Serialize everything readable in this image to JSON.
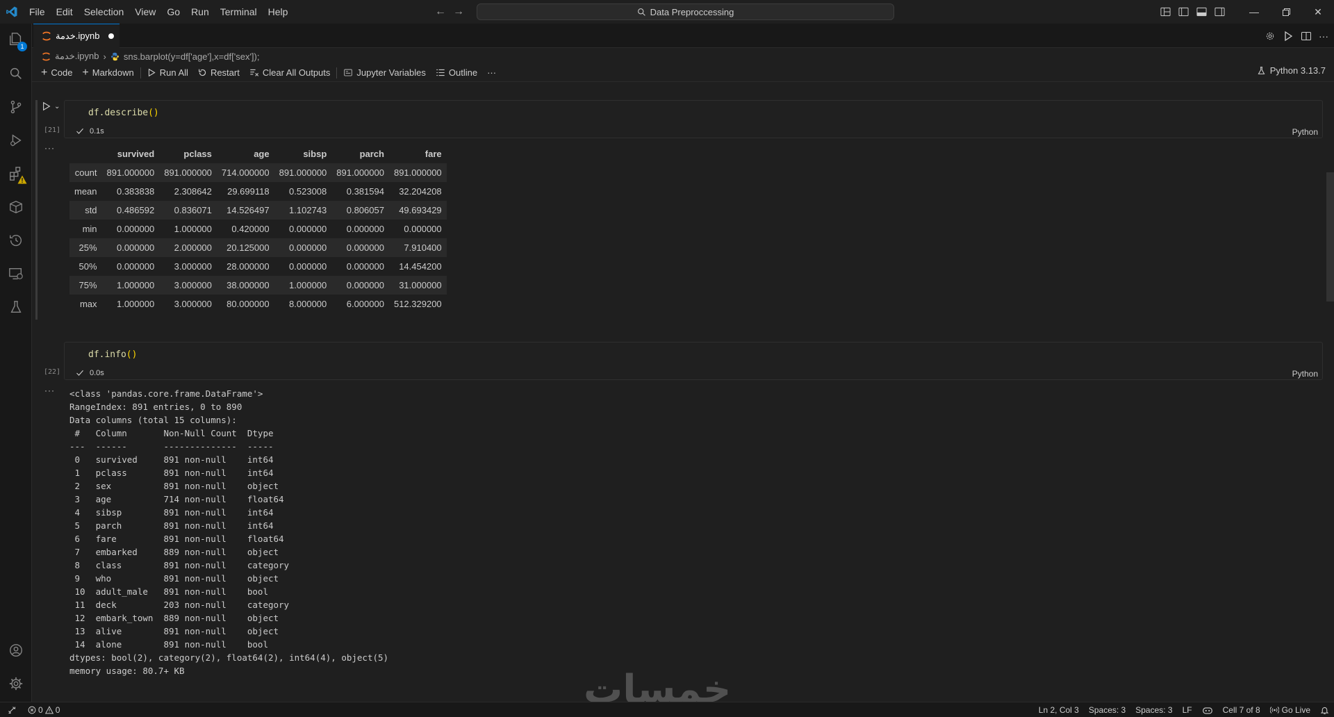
{
  "menu": [
    "File",
    "Edit",
    "Selection",
    "View",
    "Go",
    "Run",
    "Terminal",
    "Help"
  ],
  "command_center": "Data Preproccessing",
  "tab": {
    "filename": "خدمة.ipynb"
  },
  "breadcrumb": {
    "file": "خدمة.ipynb",
    "cell": "sns.barplot(y=df['age'],x=df['sex']);"
  },
  "toolbar": {
    "code": "Code",
    "markdown": "Markdown",
    "run_all": "Run All",
    "restart": "Restart",
    "clear_outputs": "Clear All Outputs",
    "variables": "Jupyter Variables",
    "outline": "Outline",
    "more": "···",
    "kernel": "Python 3.13.7"
  },
  "cells": [
    {
      "count": "[21]",
      "code_fn": "df.describe",
      "code_paren": "()",
      "time": "0.1s",
      "lang": "Python",
      "output_more": "···"
    },
    {
      "count": "[22]",
      "code_fn": "df.info",
      "code_paren": "()",
      "time": "0.0s",
      "lang": "Python",
      "output_more": "···"
    }
  ],
  "describe": {
    "columns": [
      "",
      "survived",
      "pclass",
      "age",
      "sibsp",
      "parch",
      "fare"
    ],
    "rows": [
      [
        "count",
        "891.000000",
        "891.000000",
        "714.000000",
        "891.000000",
        "891.000000",
        "891.000000"
      ],
      [
        "mean",
        "0.383838",
        "2.308642",
        "29.699118",
        "0.523008",
        "0.381594",
        "32.204208"
      ],
      [
        "std",
        "0.486592",
        "0.836071",
        "14.526497",
        "1.102743",
        "0.806057",
        "49.693429"
      ],
      [
        "min",
        "0.000000",
        "1.000000",
        "0.420000",
        "0.000000",
        "0.000000",
        "0.000000"
      ],
      [
        "25%",
        "0.000000",
        "2.000000",
        "20.125000",
        "0.000000",
        "0.000000",
        "7.910400"
      ],
      [
        "50%",
        "0.000000",
        "3.000000",
        "28.000000",
        "0.000000",
        "0.000000",
        "14.454200"
      ],
      [
        "75%",
        "1.000000",
        "3.000000",
        "38.000000",
        "1.000000",
        "0.000000",
        "31.000000"
      ],
      [
        "max",
        "1.000000",
        "3.000000",
        "80.000000",
        "8.000000",
        "6.000000",
        "512.329200"
      ]
    ]
  },
  "info_lines": [
    "<class 'pandas.core.frame.DataFrame'>",
    "RangeIndex: 891 entries, 0 to 890",
    "Data columns (total 15 columns):",
    " #   Column       Non-Null Count  Dtype   ",
    "---  ------       --------------  -----   ",
    " 0   survived     891 non-null    int64   ",
    " 1   pclass       891 non-null    int64   ",
    " 2   sex          891 non-null    object  ",
    " 3   age          714 non-null    float64 ",
    " 4   sibsp        891 non-null    int64   ",
    " 5   parch        891 non-null    int64   ",
    " 6   fare         891 non-null    float64 ",
    " 7   embarked     889 non-null    object  ",
    " 8   class        891 non-null    category",
    " 9   who          891 non-null    object  ",
    " 10  adult_male   891 non-null    bool    ",
    " 11  deck         203 non-null    category",
    " 12  embark_town  889 non-null    object  ",
    " 13  alive        891 non-null    object  ",
    " 14  alone        891 non-null    bool    ",
    "dtypes: bool(2), category(2), float64(2), int64(4), object(5)",
    "memory usage: 80.7+ KB"
  ],
  "watermark": "خمسات",
  "activity_badge": "1",
  "status": {
    "errors": "0",
    "warnings": "0",
    "position": "Ln 2, Col 3",
    "spaces1": "Spaces: 3",
    "spaces2": "Spaces: 3",
    "eol": "LF",
    "cell": "Cell 7 of 8",
    "golive": "Go Live"
  },
  "colors": {
    "accent": "#0078d4",
    "background": "#1f1f1f",
    "sidebar": "#181818",
    "warning": "#cca700"
  },
  "icons": [
    "vscode-logo-icon",
    "explorer-icon",
    "search-icon",
    "source-control-icon",
    "run-debug-icon",
    "extensions-icon",
    "packages-icon",
    "timeline-icon",
    "remote-explorer-icon",
    "testing-icon",
    "account-icon",
    "manage-gear-icon"
  ]
}
